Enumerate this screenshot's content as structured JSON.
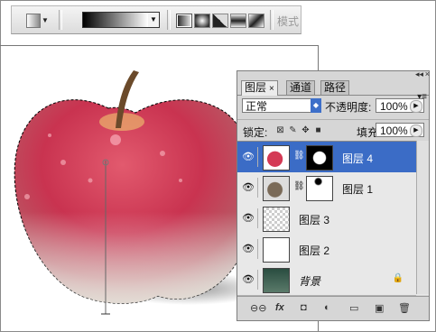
{
  "toolbar": {
    "tool_icon": "gradient-tool-icon",
    "gradient_types": [
      "linear-gradient-icon",
      "radial-gradient-icon",
      "angle-gradient-icon",
      "reflected-gradient-icon",
      "diamond-gradient-icon"
    ],
    "mode_label": "模式"
  },
  "layers_panel": {
    "tabs": [
      {
        "label": "图层",
        "active": true
      },
      {
        "label": "通道",
        "active": false
      },
      {
        "label": "路径",
        "active": false
      }
    ],
    "tab_close": "×",
    "blend_mode": "正常",
    "opacity_label": "不透明度:",
    "opacity_value": "100%",
    "lock_label": "锁定:",
    "fill_label": "填充:",
    "fill_value": "100%",
    "layers": [
      {
        "name": "图层 4",
        "selected": true,
        "thumb": "apple",
        "mask": "black-with-white"
      },
      {
        "name": "图层 1",
        "selected": false,
        "thumb": "apple-dim",
        "mask": "white-with-black"
      },
      {
        "name": "图层 3",
        "selected": false,
        "thumb": "transparent"
      },
      {
        "name": "图层 2",
        "selected": false,
        "thumb": "white"
      },
      {
        "name": "背景",
        "selected": false,
        "thumb": "apple-dark",
        "locked": true
      }
    ],
    "footer_icons": [
      "link-layers-icon",
      "fx-icon",
      "add-mask-icon",
      "adjustment-layer-icon",
      "new-group-icon",
      "new-layer-icon",
      "delete-layer-icon"
    ],
    "fx_label": "fx"
  },
  "colors": {
    "selection": "#3b6cc6",
    "panel_bg": "#d6d6d6",
    "apple_red": "#d43a55"
  }
}
